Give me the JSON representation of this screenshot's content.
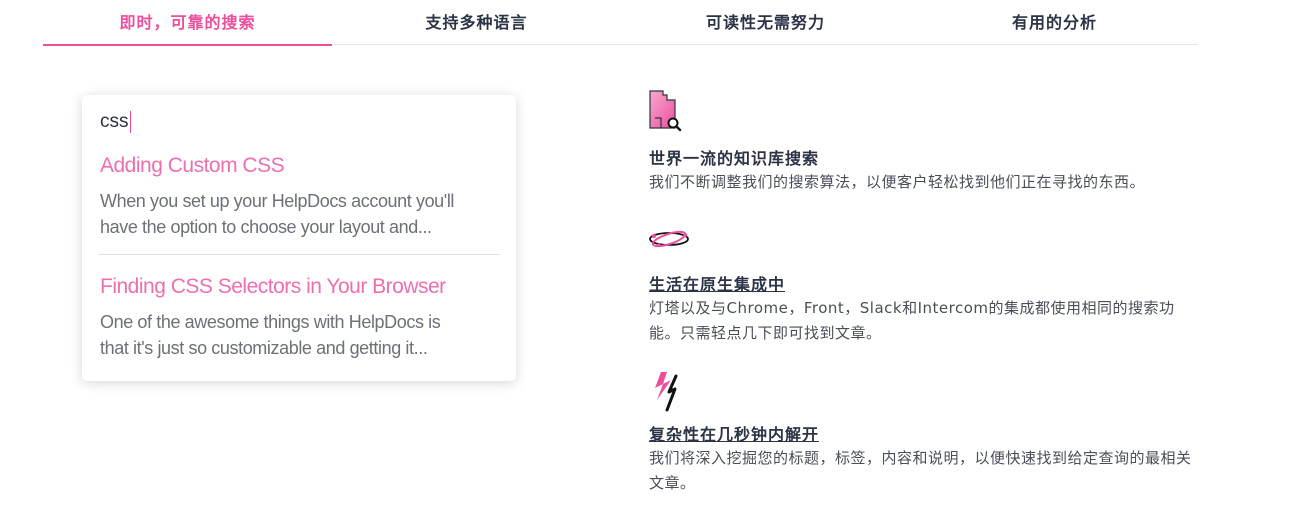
{
  "tabs": [
    {
      "label": "即时，可靠的搜索",
      "active": true
    },
    {
      "label": "支持多种语言",
      "active": false
    },
    {
      "label": "可读性无需努力",
      "active": false
    },
    {
      "label": "有用的分析",
      "active": false
    }
  ],
  "search": {
    "query": "css",
    "results": [
      {
        "title": "Adding Custom CSS",
        "excerpt_line1": "When you set up your HelpDocs account you'll",
        "excerpt_line2": "have the option to choose your layout and..."
      },
      {
        "title": "Finding CSS Selectors in Your Browser",
        "excerpt_line1": "One of the awesome things with HelpDocs is",
        "excerpt_line2": "that it's just so customizable and getting it..."
      }
    ]
  },
  "features": [
    {
      "icon": "puzzle-search-icon",
      "title": "世界一流的知识库搜索",
      "desc": "我们不断调整我们的搜索算法，以便客户轻松找到他们正在寻找的东西。"
    },
    {
      "icon": "orbit-integration-icon",
      "title": "生活在原生集成中",
      "desc": "灯塔以及与Chrome，Front，Slack和Intercom的集成都使用相同的搜索功能。只需轻点几下即可找到文章。"
    },
    {
      "icon": "lightning-bolt-icon",
      "title": "复杂性在几秒钟内解开",
      "desc": "我们将深入挖掘您的标题，标签，内容和说明，以便快速找到给定查询的最相关文章。"
    }
  ],
  "colors": {
    "accent": "#ec4f9c",
    "text": "#2c3345",
    "muted": "#6d7079"
  }
}
